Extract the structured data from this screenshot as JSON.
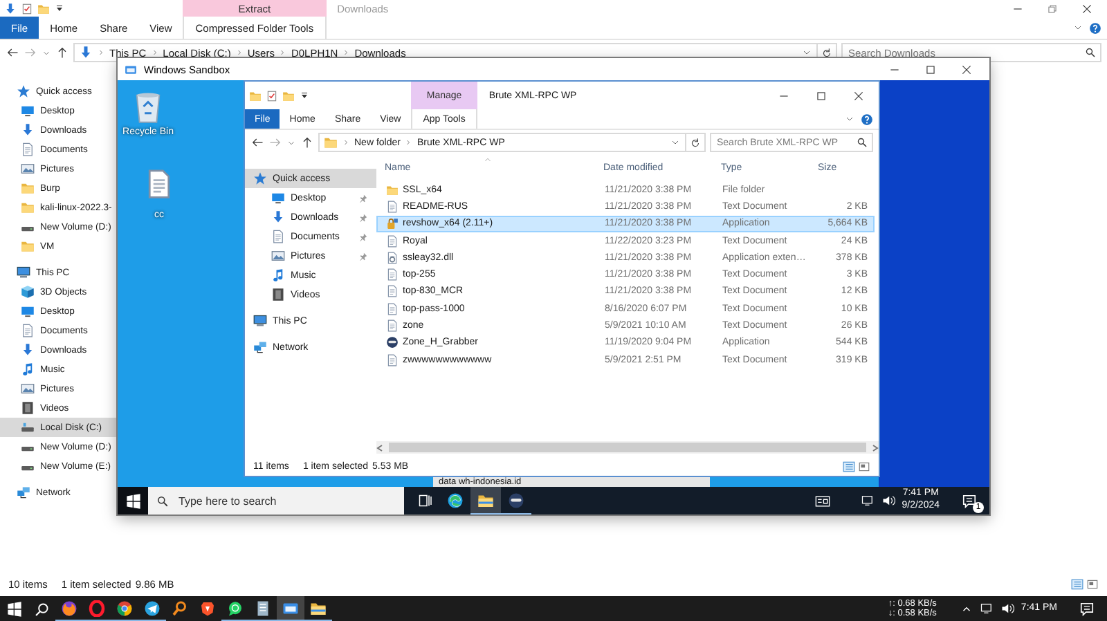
{
  "explorer": {
    "kind": "compressed",
    "maximized": true,
    "context_group": "Extract",
    "title": "Downloads",
    "ribbon_tabs": [
      {
        "label": "File",
        "kind": "file"
      },
      {
        "label": "Home",
        "kind": "tab"
      },
      {
        "label": "Share",
        "kind": "tab"
      },
      {
        "label": "View",
        "kind": "tab"
      }
    ],
    "context_tab": "Compressed Folder Tools",
    "path": [
      "This PC",
      "Local Disk (C:)",
      "Users",
      "D0LPH1N",
      "Downloads"
    ],
    "search_placeholder": "Search Downloads",
    "nav": [
      {
        "label": "Quick access",
        "kind": "star",
        "selected": false,
        "children": [
          {
            "label": "Desktop",
            "kind": "desktop",
            "selected": false
          },
          {
            "label": "Downloads",
            "kind": "download",
            "selected": false
          },
          {
            "label": "Documents",
            "kind": "document",
            "selected": false
          },
          {
            "label": "Pictures",
            "kind": "picture",
            "selected": false
          },
          {
            "label": "Burp",
            "kind": "folder",
            "selected": false
          },
          {
            "label": "kali-linux-2022.3-",
            "kind": "folder",
            "selected": false
          },
          {
            "label": "New Volume (D:)",
            "kind": "drive",
            "selected": false
          },
          {
            "label": "VM",
            "kind": "folder",
            "selected": false
          }
        ]
      },
      {
        "label": "This PC",
        "kind": "pc",
        "selected": false,
        "children": [
          {
            "label": "3D Objects",
            "kind": "cube",
            "selected": false
          },
          {
            "label": "Desktop",
            "kind": "desktop",
            "selected": false
          },
          {
            "label": "Documents",
            "kind": "document",
            "selected": false
          },
          {
            "label": "Downloads",
            "kind": "download",
            "selected": false
          },
          {
            "label": "Music",
            "kind": "music",
            "selected": false
          },
          {
            "label": "Pictures",
            "kind": "picture",
            "selected": false
          },
          {
            "label": "Videos",
            "kind": "video",
            "selected": false
          },
          {
            "label": "Local Disk (C:)",
            "kind": "disk",
            "selected": true
          },
          {
            "label": "New Volume (D:)",
            "kind": "drive",
            "selected": false
          },
          {
            "label": "New Volume (E:)",
            "kind": "drive",
            "selected": false
          }
        ]
      },
      {
        "label": "Network",
        "kind": "network",
        "selected": false
      }
    ],
    "status": {
      "count": "10 items",
      "selection": "1 item selected",
      "size": "9.86 MB"
    }
  },
  "sandbox": {
    "title": "Windows Sandbox",
    "desktop_icons": [
      {
        "label": "Recycle Bin",
        "kind": "recycle"
      },
      {
        "label": "cc",
        "kind": "text"
      }
    ],
    "explorer": {
      "kind": "app",
      "maximized": false,
      "context_group": "Manage",
      "title": "Brute XML-RPC WP",
      "ribbon_tabs": [
        {
          "label": "File",
          "kind": "file"
        },
        {
          "label": "Home",
          "kind": "tab"
        },
        {
          "label": "Share",
          "kind": "tab"
        },
        {
          "label": "View",
          "kind": "tab"
        }
      ],
      "context_tab": "App Tools",
      "path": [
        "New folder",
        "Brute XML-RPC WP"
      ],
      "search_placeholder": "Search Brute XML-RPC WP",
      "nav": [
        {
          "label": "Quick access",
          "kind": "star",
          "selected": true,
          "children": [
            {
              "label": "Desktop",
              "kind": "desktop",
              "selected": false,
              "pinned": true
            },
            {
              "label": "Downloads",
              "kind": "download",
              "selected": false,
              "pinned": true
            },
            {
              "label": "Documents",
              "kind": "document",
              "selected": false,
              "pinned": true
            },
            {
              "label": "Pictures",
              "kind": "picture",
              "selected": false,
              "pinned": true
            },
            {
              "label": "Music",
              "kind": "music",
              "selected": false,
              "pinned": false
            },
            {
              "label": "Videos",
              "kind": "video",
              "selected": false,
              "pinned": false
            }
          ]
        },
        {
          "label": "This PC",
          "kind": "pc",
          "selected": false
        },
        {
          "label": "Network",
          "kind": "network",
          "selected": false
        }
      ],
      "files": {
        "columns": [
          "Name",
          "Date modified",
          "Type",
          "Size"
        ],
        "rows": [
          {
            "name": "SSL_x64",
            "date": "11/21/2020 3:38 PM",
            "type": "File folder",
            "size": "",
            "kind": "folder",
            "selected": false
          },
          {
            "name": "README-RUS",
            "date": "11/21/2020 3:38 PM",
            "type": "Text Document",
            "size": "2 KB",
            "kind": "text",
            "selected": false
          },
          {
            "name": "revshow_x64 (2.11+)",
            "date": "11/21/2020 3:38 PM",
            "type": "Application",
            "size": "5,664 KB",
            "kind": "app",
            "selected": true
          },
          {
            "name": "Royal",
            "date": "11/22/2020 3:23 PM",
            "type": "Text Document",
            "size": "24 KB",
            "kind": "text",
            "selected": false
          },
          {
            "name": "ssleay32.dll",
            "date": "11/21/2020 3:38 PM",
            "type": "Application exten…",
            "size": "378 KB",
            "kind": "dll",
            "selected": false
          },
          {
            "name": "top-255",
            "date": "11/21/2020 3:38 PM",
            "type": "Text Document",
            "size": "3 KB",
            "kind": "text",
            "selected": false
          },
          {
            "name": "top-830_MCR",
            "date": "11/21/2020 3:38 PM",
            "type": "Text Document",
            "size": "12 KB",
            "kind": "text",
            "selected": false
          },
          {
            "name": "top-pass-1000",
            "date": "8/16/2020 6:07 PM",
            "type": "Text Document",
            "size": "10 KB",
            "kind": "text",
            "selected": false
          },
          {
            "name": "zone",
            "date": "5/9/2021 10:10 AM",
            "type": "Text Document",
            "size": "26 KB",
            "kind": "text",
            "selected": false
          },
          {
            "name": "Zone_H_Grabber",
            "date": "11/19/2020 9:04 PM",
            "type": "Application",
            "size": "544 KB",
            "kind": "mask",
            "selected": false
          },
          {
            "name": "zwwwwwwwwwwww",
            "date": "5/9/2021 2:51 PM",
            "type": "Text Document",
            "size": "319 KB",
            "kind": "text",
            "selected": false
          }
        ]
      },
      "status": {
        "count": "11 items",
        "selection": "1 item selected",
        "size": "5.53 MB"
      }
    },
    "background_window_text": "data wh-indonesia.id",
    "taskbar": {
      "search_placeholder": "Type here to search",
      "apps": [
        {
          "kind": "taskview",
          "running": false,
          "selected": false
        },
        {
          "kind": "edge",
          "running": false,
          "selected": false
        },
        {
          "kind": "explorer",
          "running": true,
          "selected": true
        },
        {
          "kind": "mask",
          "running": true,
          "selected": false
        }
      ],
      "time": "7:41 PM",
      "date": "9/2/2024",
      "notification_count": "1"
    }
  },
  "taskbar": {
    "apps": [
      {
        "kind": "firefox",
        "running": true,
        "selected": false
      },
      {
        "kind": "opera",
        "running": true,
        "selected": false
      },
      {
        "kind": "chrome",
        "running": true,
        "selected": false
      },
      {
        "kind": "telegram",
        "running": true,
        "selected": false
      },
      {
        "kind": "magnifier",
        "running": false,
        "selected": false
      },
      {
        "kind": "brave",
        "running": false,
        "selected": false
      },
      {
        "kind": "whatsapp",
        "running": true,
        "selected": false
      },
      {
        "kind": "notebook",
        "running": true,
        "selected": false
      },
      {
        "kind": "sandbox",
        "running": true,
        "selected": true
      },
      {
        "kind": "explorer",
        "running": true,
        "selected": false
      }
    ],
    "upload": "↑: 0.68 KB/s",
    "download": "↓: 0.58 KB/s",
    "time": "7:41 PM"
  }
}
